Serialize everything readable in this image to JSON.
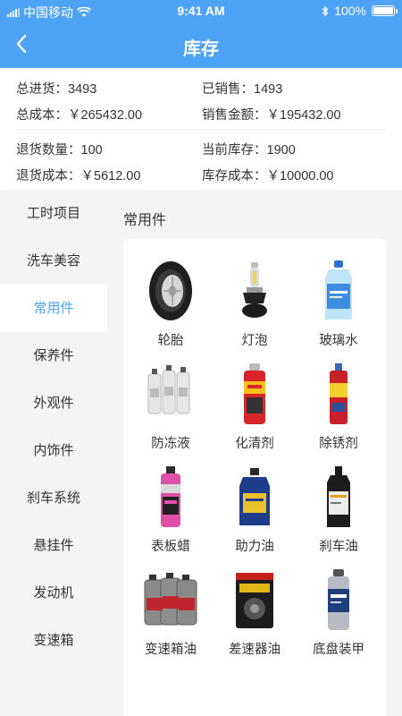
{
  "status_bar": {
    "carrier": "中国移动",
    "time": "9:41 AM",
    "battery": "100%"
  },
  "header": {
    "title": "库存"
  },
  "summary": {
    "total_in_label": "总进货：",
    "total_in": "3493",
    "sold_label": "已销售：",
    "sold": "1493",
    "total_cost_label": "总成本：",
    "total_cost": "￥265432.00",
    "sales_amount_label": "销售金额：",
    "sales_amount": "￥195432.00",
    "return_qty_label": "退货数量：",
    "return_qty": "100",
    "current_stock_label": "当前库存：",
    "current_stock": "1900",
    "return_cost_label": "退货成本：",
    "return_cost": "￥5612.00",
    "stock_cost_label": "库存成本：",
    "stock_cost": "￥10000.00"
  },
  "sidebar": {
    "active_index": 2,
    "items": [
      {
        "label": "工时项目"
      },
      {
        "label": "洗车美容"
      },
      {
        "label": "常用件"
      },
      {
        "label": "保养件"
      },
      {
        "label": "外观件"
      },
      {
        "label": "内饰件"
      },
      {
        "label": "刹车系统"
      },
      {
        "label": "悬挂件"
      },
      {
        "label": "发动机"
      },
      {
        "label": "变速箱"
      }
    ]
  },
  "section": {
    "title": "常用件",
    "items": [
      {
        "label": "轮胎",
        "icon": "tire-icon"
      },
      {
        "label": "灯泡",
        "icon": "bulb-icon"
      },
      {
        "label": "玻璃水",
        "icon": "washer-fluid-icon"
      },
      {
        "label": "防冻液",
        "icon": "antifreeze-icon"
      },
      {
        "label": "化清剂",
        "icon": "cleaner-spray-icon"
      },
      {
        "label": "除锈剂",
        "icon": "rust-remover-icon"
      },
      {
        "label": "表板蜡",
        "icon": "dashboard-wax-icon"
      },
      {
        "label": "助力油",
        "icon": "power-steering-oil-icon"
      },
      {
        "label": "刹车油",
        "icon": "brake-fluid-icon"
      },
      {
        "label": "变速箱油",
        "icon": "transmission-oil-icon"
      },
      {
        "label": "差速器油",
        "icon": "differential-oil-icon"
      },
      {
        "label": "底盘装甲",
        "icon": "underbody-coating-icon"
      }
    ]
  },
  "colors": {
    "accent": "#4fa3f7",
    "background": "#f4f4f4"
  }
}
